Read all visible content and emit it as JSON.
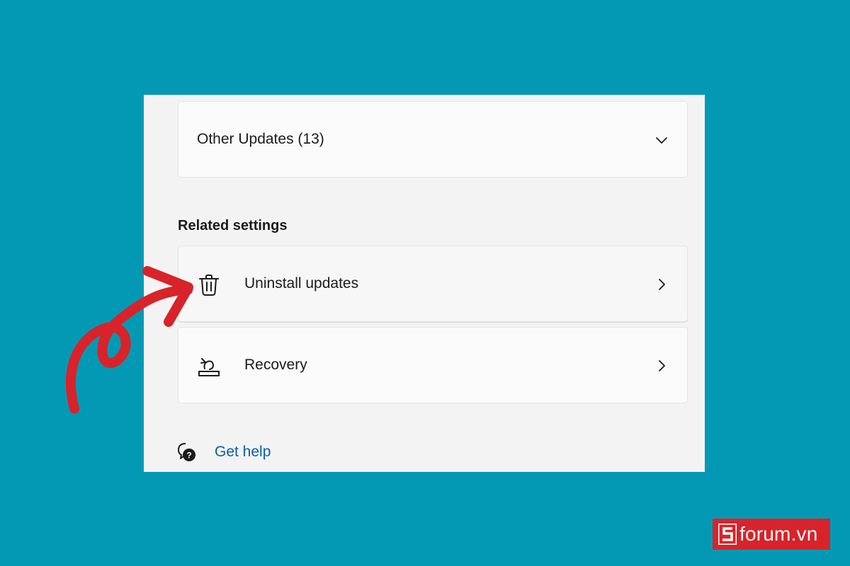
{
  "other_updates": {
    "label": "Other Updates (13)",
    "icon": "chevron-down-icon"
  },
  "related_settings": {
    "heading": "Related settings",
    "items": [
      {
        "label": "Uninstall updates",
        "icon": "trash-icon"
      },
      {
        "label": "Recovery",
        "icon": "recovery-icon"
      }
    ]
  },
  "help": {
    "label": "Get help",
    "icon": "help-chat-icon"
  },
  "watermark": {
    "text": "forum.vn",
    "accent": "#d8232a"
  },
  "colors": {
    "background": "#0399b4",
    "annotation_arrow": "#d8232a",
    "link": "#0a5eab"
  }
}
